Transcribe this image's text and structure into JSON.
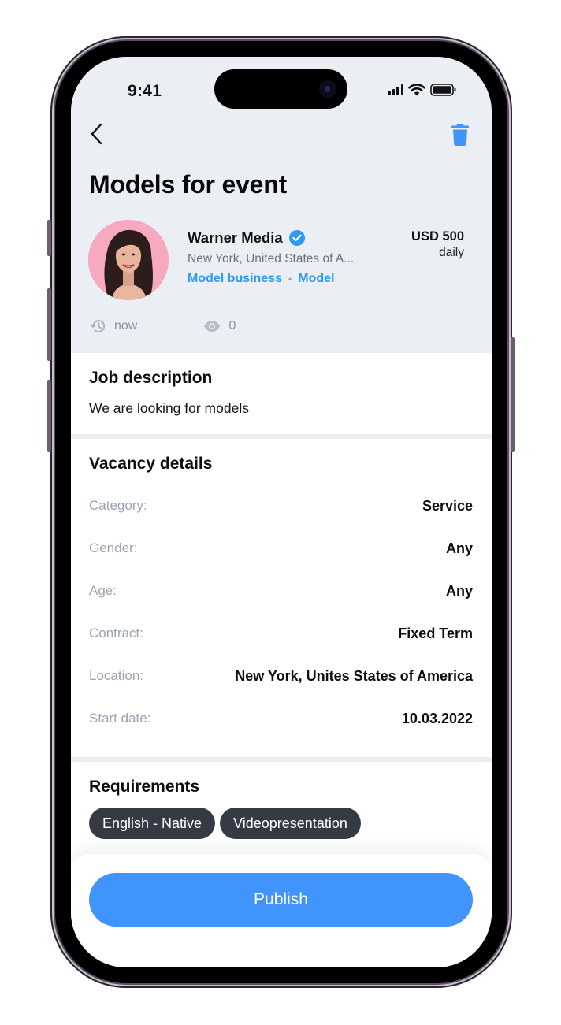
{
  "status_bar": {
    "time": "9:41",
    "icons": [
      "cellular-signal-icon",
      "wifi-icon",
      "battery-icon"
    ]
  },
  "nav": {
    "back_icon": "chevron-left-icon",
    "delete_icon": "trash-icon"
  },
  "page": {
    "title": "Models for event"
  },
  "employer": {
    "name": "Warner Media",
    "verified": true,
    "location": "New York, United States of A...",
    "tags": [
      "Model business",
      "Model"
    ],
    "price_amount": "USD 500",
    "price_period": "daily"
  },
  "meta": {
    "posted": "now",
    "views": "0"
  },
  "job_description": {
    "title": "Job description",
    "text": "We are looking for models"
  },
  "vacancy_details": {
    "title": "Vacancy details",
    "rows": [
      {
        "label": "Category:",
        "value": "Service"
      },
      {
        "label": "Gender:",
        "value": "Any"
      },
      {
        "label": "Age:",
        "value": "Any"
      },
      {
        "label": "Contract:",
        "value": "Fixed Term"
      },
      {
        "label": "Location:",
        "value": "New York, Unites States of America"
      },
      {
        "label": "Start date:",
        "value": "10.03.2022"
      }
    ]
  },
  "requirements": {
    "title": "Requirements",
    "chips": [
      "English - Native",
      "Videopresentation"
    ]
  },
  "actions": {
    "publish_label": "Publish"
  },
  "colors": {
    "accent": "#4194fb",
    "link": "#2e9cf2",
    "header_bg": "#ebeef3",
    "chip_bg": "#363a45",
    "label_gray": "#9ba3b2"
  }
}
